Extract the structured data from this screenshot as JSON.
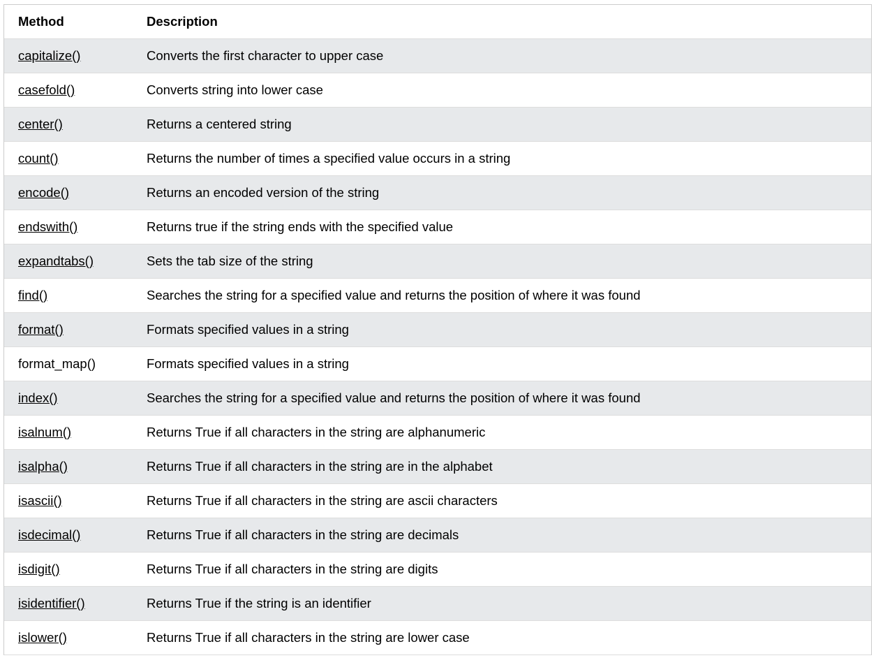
{
  "table": {
    "headers": {
      "method": "Method",
      "description": "Description"
    },
    "rows": [
      {
        "method": "capitalize()",
        "description": "Converts the first character to upper case",
        "link": true
      },
      {
        "method": "casefold()",
        "description": "Converts string into lower case",
        "link": true
      },
      {
        "method": "center()",
        "description": "Returns a centered string",
        "link": true
      },
      {
        "method": "count()",
        "description": "Returns the number of times a specified value occurs in a string",
        "link": true
      },
      {
        "method": "encode()",
        "description": "Returns an encoded version of the string",
        "link": true
      },
      {
        "method": "endswith()",
        "description": "Returns true if the string ends with the specified value",
        "link": true
      },
      {
        "method": "expandtabs()",
        "description": "Sets the tab size of the string",
        "link": true
      },
      {
        "method": "find()",
        "description": "Searches the string for a specified value and returns the position of where it was found",
        "link": true
      },
      {
        "method": "format()",
        "description": "Formats specified values in a string",
        "link": true
      },
      {
        "method": "format_map()",
        "description": "Formats specified values in a string",
        "link": false
      },
      {
        "method": "index()",
        "description": "Searches the string for a specified value and returns the position of where it was found",
        "link": true
      },
      {
        "method": "isalnum()",
        "description": "Returns True if all characters in the string are alphanumeric",
        "link": true
      },
      {
        "method": "isalpha()",
        "description": "Returns True if all characters in the string are in the alphabet",
        "link": true
      },
      {
        "method": "isascii()",
        "description": "Returns True if all characters in the string are ascii characters",
        "link": true
      },
      {
        "method": "isdecimal()",
        "description": "Returns True if all characters in the string are decimals",
        "link": true
      },
      {
        "method": "isdigit()",
        "description": "Returns True if all characters in the string are digits",
        "link": true
      },
      {
        "method": "isidentifier()",
        "description": "Returns True if the string is an identifier",
        "link": true
      },
      {
        "method": "islower()",
        "description": "Returns True if all characters in the string are lower case",
        "link": true
      }
    ]
  },
  "colors": {
    "row_stripe": "#e7e9eb",
    "row_plain": "#ffffff",
    "border": "#dddddd"
  }
}
